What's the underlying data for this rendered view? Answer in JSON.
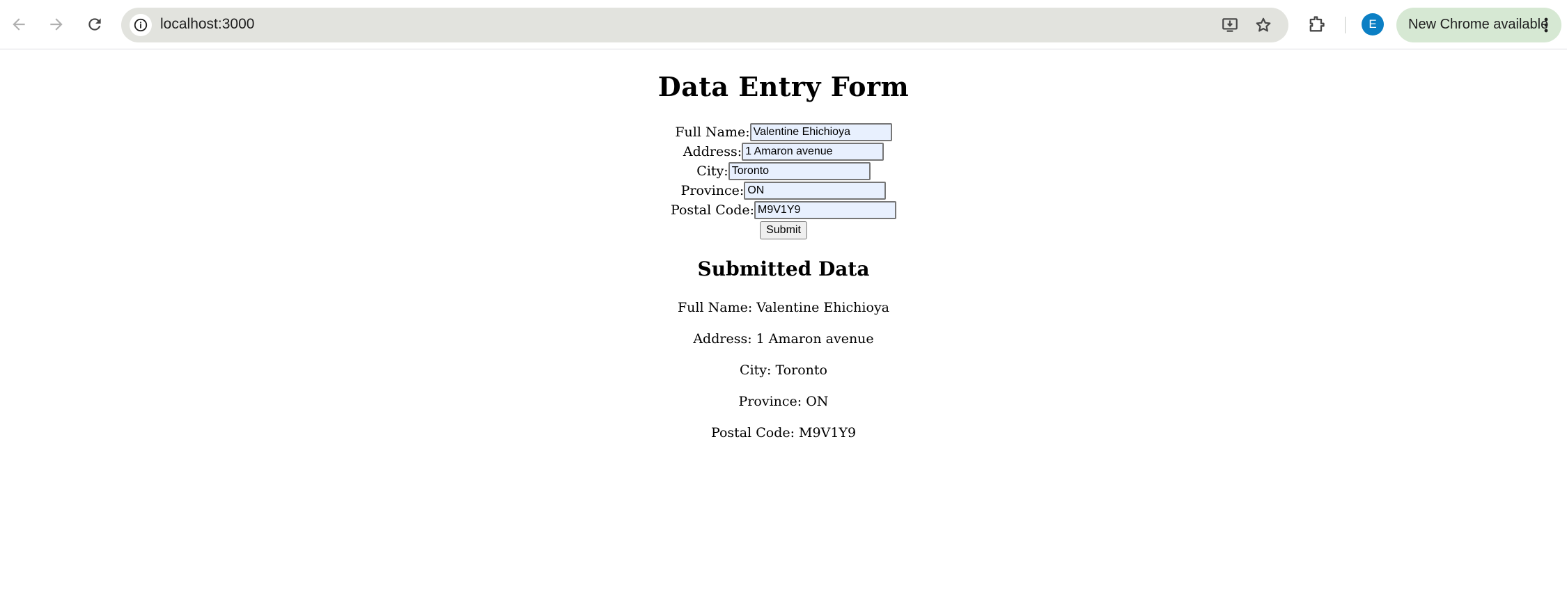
{
  "browser": {
    "url": "localhost:3000",
    "profile_initial": "E",
    "update_chip_label": "New Chrome available",
    "icons": [
      "back-icon",
      "forward-icon",
      "reload-icon",
      "info-icon",
      "install-app-icon",
      "bookmark-star-icon",
      "extensions-icon",
      "more-menu-icon"
    ],
    "avatar_color": "#0b7fc4",
    "update_chip_color": "#d6e8d3"
  },
  "form": {
    "title": "Data Entry Form",
    "fields": {
      "full_name": {
        "label": "Full Name:",
        "value": "Valentine Ehichioya"
      },
      "address": {
        "label": "Address:",
        "value": "1 Amaron avenue"
      },
      "city": {
        "label": "City:",
        "value": "Toronto"
      },
      "province": {
        "label": "Province:",
        "value": "ON"
      },
      "postal_code": {
        "label": "Postal Code:",
        "value": "M9V1Y9"
      }
    },
    "submit_label": "Submit",
    "autofill_color": "#e8f0fe"
  },
  "submitted": {
    "title": "Submitted Data",
    "lines": {
      "full_name": "Full Name: Valentine Ehichioya",
      "address": "Address: 1 Amaron avenue",
      "city": "City: Toronto",
      "province": "Province: ON",
      "postal_code": "Postal Code: M9V1Y9"
    }
  }
}
